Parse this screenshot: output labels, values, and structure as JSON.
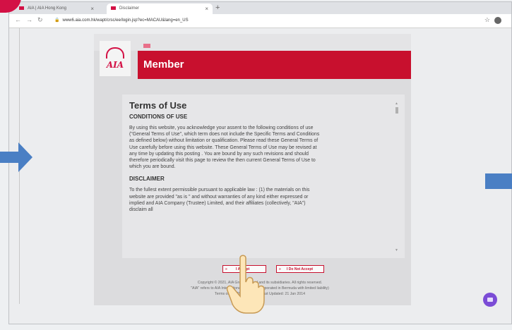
{
  "browser": {
    "tabs": [
      {
        "label": "AIA | AIA Hong Kong"
      },
      {
        "label": "Disclaimer"
      }
    ],
    "new_tab_label": "+",
    "close_label": "×",
    "url": "www6.aia.com.hk/wapt/crsc/ee/login.jsp?ec=MACAU&lang=en_US"
  },
  "page": {
    "brand_logo_text": "AIA",
    "banner_title": "Member",
    "terms": {
      "heading": "Terms of Use",
      "conditions_heading": "CONDITIONS OF USE",
      "conditions_text": "By using this website, you acknowledge your assent to the following conditions of use (\"General Terms of Use\", which term does not include the Specific Terms and Conditions as defined below) without limitation or qualification. Please read these General Terms of Use carefully before using this website. These General Terms of Use may be revised at any time by updating this posting . You are bound by any such revisions and should therefore periodically visit this page to review the then current General Terms of Use to which you are bound.",
      "disclaimer_heading": "DISCLAIMER",
      "disclaimer_text": "To the fullest extent permissible pursuant to applicable law : (1) the materials on this website are provided \"as is \" and without warranties of any kind either expressed or implied and AIA Company (Trustee) Limited, and their affiliates (collectively, \"AIA\") disclaim all"
    },
    "buttons": {
      "accept_label": "I Accept",
      "decline_label": "I Do Not Accept",
      "arrow_glyph": "»"
    },
    "footer": {
      "line1": "Copyright © 2021, AIA Group Limited and its subsidiaries. All rights reserved.",
      "line2": "\"AIA\" refers to AIA International Limited (incorporated in Bermuda with limited liability)",
      "line3": "Terms of Use   Privacy Policy   Last Updated: 21 Jan 2014"
    }
  },
  "overlay": {
    "icons": [
      "blue-arrow-right-icon",
      "blue-arrow-left-icon",
      "pointing-hand-icon",
      "video-chat-icon"
    ],
    "colors": {
      "aia_red": "#c8102e",
      "arrow_blue": "#4a7fc4",
      "fab_purple": "#7b4cd6"
    }
  }
}
